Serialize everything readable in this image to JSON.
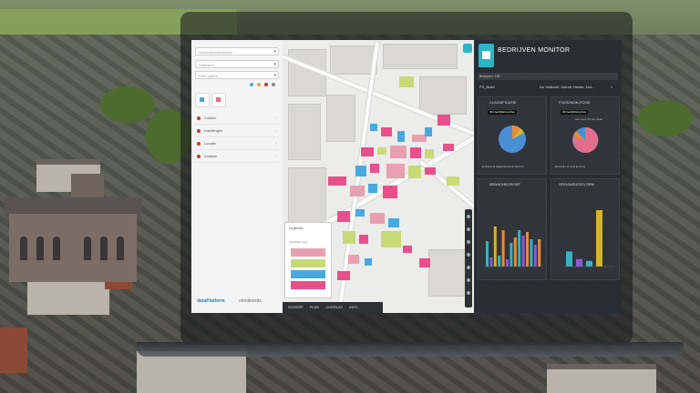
{
  "dashboard": {
    "title": "BEDRIJVEN MONITOR",
    "header_left": "Bedrijven: 128",
    "header_mid": "",
    "filter_left": "PS_Build",
    "filter_mid": "De Vollezee, Zuthof, Hesse, Hol...",
    "panels": {
      "a_title": "CLASSIFICATIE",
      "a_chip": "301 bedrijfsbranches",
      "b_title": "FOOD/NON-FOOD",
      "b_chip": "30 bedrijfsbranches",
      "b_sub": "Non-food: 9/9 van totaal",
      "c_title": "BRANCHEGROEP",
      "d_title": "ORGANISATIEVORM",
      "legend_a": "■ winkels  ■ dagwinkels  ■ ambachten",
      "legend_b": "■ food  ■ non-food  ■ overig"
    },
    "colors": {
      "accent": "#2cb5c4",
      "pie_main": "#4a8fd6",
      "pie_alt": "#e0708c",
      "bar_teal": "#38b3c4",
      "bar_orange": "#e88c3c",
      "bar_yellow": "#d4b42a",
      "bar_purple": "#8c5bd0"
    },
    "branchegroep_values": [
      28,
      10,
      44,
      12,
      40,
      8,
      26,
      32,
      40,
      34,
      38,
      30,
      24,
      30
    ],
    "organisatievorm_values": [
      16,
      8,
      6,
      60
    ]
  },
  "left_panel": {
    "selects": [
      "Gebiedsonderscheid",
      "Selecteer",
      "Filter opties"
    ],
    "menu": [
      "Zoeken",
      "Instellingen",
      "Locatie",
      "Analyse"
    ],
    "logo_a": "dataPlatform",
    "logo_b": "omnitrends"
  },
  "map": {
    "legend_title": "Legenda",
    "legend_sub": "Food/Non-food",
    "legend_colors": [
      "#e8a0b0",
      "#c8da78",
      "#4aa8e0",
      "#e8508a"
    ],
    "bottombar": [
      "SCHERP",
      "PLAN",
      "OVERLAY",
      "INFO"
    ]
  }
}
